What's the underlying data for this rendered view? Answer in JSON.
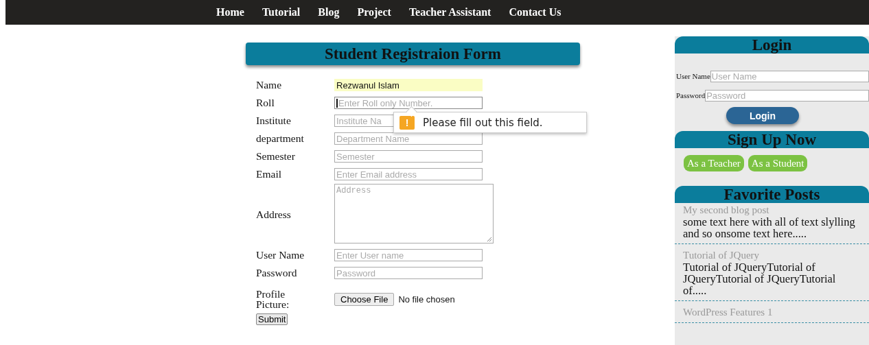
{
  "nav": {
    "items": [
      {
        "label": "Home"
      },
      {
        "label": "Tutorial"
      },
      {
        "label": "Blog"
      },
      {
        "label": "Project"
      },
      {
        "label": "Teacher Assistant"
      },
      {
        "label": "Contact Us"
      }
    ]
  },
  "form": {
    "title": "Student Registraion Form",
    "fields": [
      {
        "kind": "text",
        "label": "Name",
        "value": "Rezwanul Islam",
        "autofilled": true,
        "focused": false
      },
      {
        "kind": "text",
        "label": "Roll",
        "placeholder": "Enter Roll only Number.",
        "autofilled": false,
        "focused": true
      },
      {
        "kind": "text",
        "label": "Institute",
        "placeholder": "Institute Na",
        "autofilled": false,
        "focused": false
      },
      {
        "kind": "text",
        "label": "department",
        "placeholder": "Department Name",
        "autofilled": false,
        "focused": false
      },
      {
        "kind": "text",
        "label": "Semester",
        "placeholder": "Semester",
        "autofilled": false,
        "focused": false
      },
      {
        "kind": "text",
        "label": "Email",
        "placeholder": "Enter Email address",
        "autofilled": false,
        "focused": false
      },
      {
        "kind": "textarea",
        "label": "Address",
        "placeholder": "Address"
      },
      {
        "kind": "text",
        "label": "User Name",
        "placeholder": "Enter User name",
        "autofilled": false,
        "focused": false
      },
      {
        "kind": "text",
        "label": "Password",
        "placeholder": "Password",
        "autofilled": false,
        "focused": false
      },
      {
        "kind": "file",
        "label": "Profile Picture:",
        "button": "Choose File",
        "status": "No file chosen"
      }
    ],
    "submit": "Submit",
    "tooltip": {
      "icon": "!",
      "message": "Please fill out this field."
    }
  },
  "sidebar": {
    "login": {
      "title": "Login",
      "fields": [
        {
          "label": "User Name",
          "placeholder": "User Name"
        },
        {
          "label": "Password",
          "placeholder": "Password"
        }
      ],
      "button": "Login"
    },
    "signup": {
      "title": "Sign Up Now",
      "buttons": [
        "As a Teacher",
        "As a Student"
      ]
    },
    "favorites": {
      "title": "Favorite Posts",
      "posts": [
        {
          "title": "My second blog post",
          "excerpt": "some text here with all of text slylling and so onsome text here....."
        },
        {
          "title": "Tutorial of JQuery",
          "excerpt": "Tutorial of JQueryTutorial of JQueryTutorial of JQueryTutorial of....."
        },
        {
          "title": "WordPress Features 1"
        }
      ]
    }
  }
}
